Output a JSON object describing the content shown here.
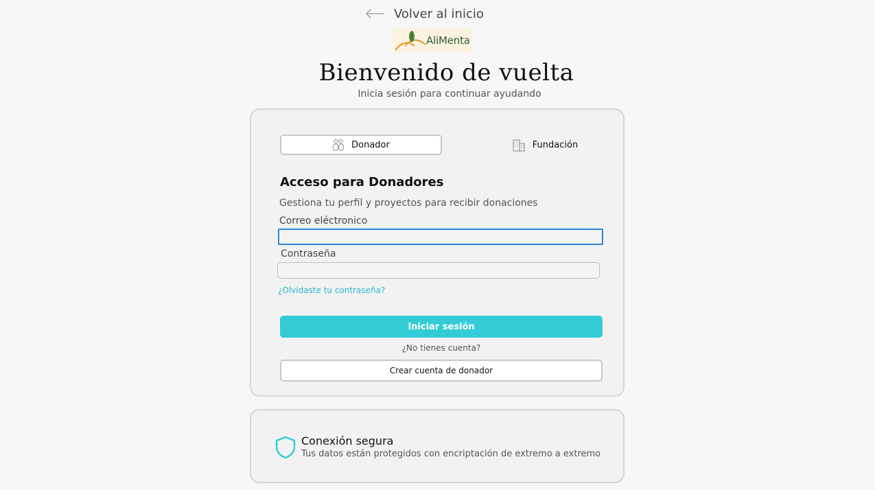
{
  "header": {
    "back_label": "Volver al inicio",
    "back_icon": "arrow-left-icon",
    "logo_text": "AliMenta",
    "title": "Bienvenido de vuelta",
    "subtitle": "Inicia sesión para continuar ayudando"
  },
  "tabs": [
    {
      "label": "Donador",
      "icon": "users-icon",
      "selected": true
    },
    {
      "label": "Fundación",
      "icon": "building-icon",
      "selected": false
    }
  ],
  "form": {
    "section_title": "Acceso para Donadores",
    "section_desc": "Gestiona tu perfil y proyectos para recibir donaciones",
    "email_label": "Correo eléctronico",
    "email_value": "",
    "password_label": "Contraseña",
    "password_value": "",
    "forgot_label": "¿Olvidaste tu contraseña?",
    "login_label": "Iniciar sesión",
    "no_account_label": "¿No tienes cuenta?",
    "create_label": "Crear cuenta de donador"
  },
  "secure": {
    "icon": "shield-icon",
    "title": "Conexión segura",
    "desc": "Tus datos están protegidos con encriptación de extremo a extremo"
  },
  "colors": {
    "accent": "#33ccd6",
    "link": "#2fb6c9",
    "focus": "#2a86d8",
    "background": "#f7f7f7",
    "logo_green": "#2f5d2a",
    "logo_orange": "#e39a2b"
  }
}
